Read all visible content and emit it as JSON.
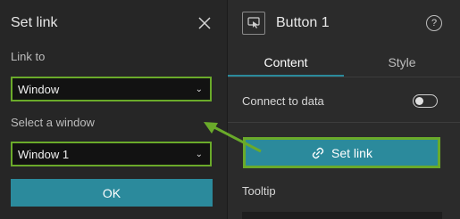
{
  "set_link_panel": {
    "title": "Set link",
    "link_to_label": "Link to",
    "link_to_value": "Window",
    "select_window_label": "Select a window",
    "select_window_value": "Window 1",
    "ok_label": "OK"
  },
  "component_panel": {
    "title": "Button 1",
    "tabs": [
      {
        "label": "Content",
        "active": true
      },
      {
        "label": "Style",
        "active": false
      }
    ],
    "connect_label": "Connect to data",
    "connect_enabled": false,
    "set_link_label": "Set link",
    "tooltip_label": "Tooltip"
  },
  "colors": {
    "accent": "#2b8a9c",
    "highlight": "#6aaa2a",
    "panel_bg": "#262626",
    "field_bg": "#121212"
  },
  "icons": {
    "close": "close-icon",
    "component": "button-widget-icon",
    "help": "help-icon",
    "link": "link-icon",
    "dropdown": "chevron-down-icon"
  }
}
